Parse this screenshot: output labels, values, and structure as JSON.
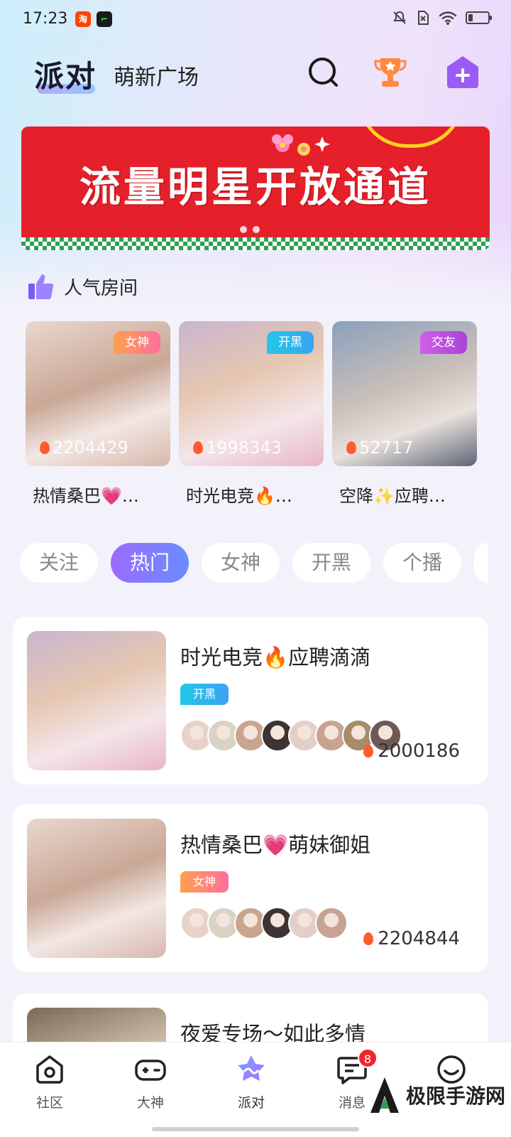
{
  "status_bar": {
    "time": "17:23",
    "app_icons": [
      {
        "name": "taobao-icon",
        "color": "#ff4400",
        "glyph": "淘"
      },
      {
        "name": "app-icon",
        "color": "#1a1a1a",
        "glyph": "⌐"
      }
    ],
    "icons": [
      "mute-icon",
      "sim-off-icon",
      "wifi-icon",
      "battery-icon"
    ]
  },
  "header": {
    "title": "派对",
    "subtitle": "萌新广场",
    "icons": [
      "search-icon",
      "trophy-icon",
      "create-room-icon"
    ]
  },
  "banner": {
    "text": "流量明星开放通道",
    "background": "#e5202a",
    "dots": 2
  },
  "popular": {
    "title": "人气房间",
    "rooms": [
      {
        "tag": "女神",
        "tag_color": "#ff7d9e",
        "count": "2204429",
        "name": "热情桑巴💗…",
        "bg": "linear-gradient(160deg,#e9d7cf,#c9a896 45%,#f2e7e4 70%,#d7b8ab)"
      },
      {
        "tag": "开黑",
        "tag_color": "#2fc4e6",
        "count": "1998343",
        "name": "时光电竞🔥…",
        "bg": "linear-gradient(160deg,#c9b5cf,#e5c7b1 40%,#f4e5e9 70%,#e8b6c7)"
      },
      {
        "tag": "交友",
        "tag_color": "#c04fd6",
        "count": "52717",
        "name": "空降✨应聘…",
        "bg": "linear-gradient(160deg,#8aa0bd,#c9bfb9 45%,#e9e1dc 70%,#5b6677)"
      }
    ]
  },
  "tabs": [
    {
      "label": "关注",
      "active": false
    },
    {
      "label": "热门",
      "active": true
    },
    {
      "label": "女神",
      "active": false
    },
    {
      "label": "开黑",
      "active": false
    },
    {
      "label": "个播",
      "active": false
    }
  ],
  "rooms": [
    {
      "title": "时光电竞🔥应聘滴滴",
      "tag": "开黑",
      "tag_color": "#2fc4e6",
      "count": "2000186",
      "avatar_count": 8,
      "bg": "linear-gradient(160deg,#c9b5cf,#e5c7b1 40%,#f4e5e9 70%,#e8b6c7)"
    },
    {
      "title": "热情桑巴💗萌妹御姐",
      "tag": "女神",
      "tag_color": "#ff7d9e",
      "count": "2204844",
      "avatar_count": 6,
      "bg": "linear-gradient(160deg,#e9d7cf,#c9a896 45%,#f2e7e4 70%,#d7b8ab)"
    },
    {
      "title": "夜爱专场～如此多情",
      "tag": "",
      "tag_color": "#ff7d9e",
      "count": "",
      "avatar_count": 0,
      "bg": "linear-gradient(160deg,#7a6a55,#d9c8b4 50%,#3d3327)"
    }
  ],
  "bottom_nav": [
    {
      "label": "社区",
      "icon": "home-icon",
      "active": false
    },
    {
      "label": "大神",
      "icon": "gamepad-icon",
      "active": false
    },
    {
      "label": "派对",
      "icon": "party-icon",
      "active": true
    },
    {
      "label": "消息",
      "icon": "message-icon",
      "active": false,
      "badge": "8"
    },
    {
      "label": "",
      "icon": "profile-icon",
      "active": false
    }
  ],
  "watermark": "极限手游网"
}
